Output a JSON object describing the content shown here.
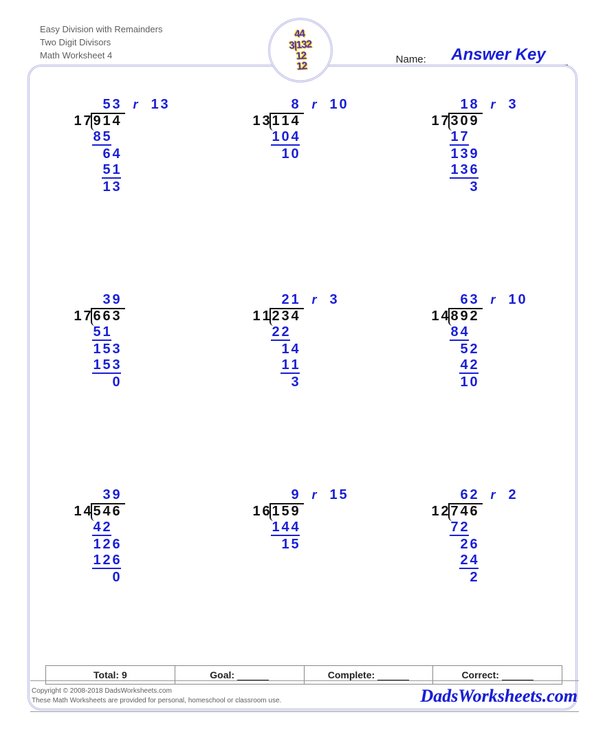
{
  "header": {
    "title_line1": "Easy Division with Remainders",
    "title_line2": "Two Digit Divisors",
    "title_line3": "Math Worksheet 4",
    "name_label": "Name:",
    "name_value": "Answer Key",
    "logo_text": "44\n3|132\n12\n12"
  },
  "problems": [
    {
      "divisor": "17",
      "dividend": "914",
      "quotient": "53",
      "remainder": "13",
      "steps": [
        {
          "val": "85",
          "offset": 0,
          "ul": true
        },
        {
          "val": "64",
          "offset": 1,
          "ul": false
        },
        {
          "val": "51",
          "offset": 1,
          "ul": true
        },
        {
          "val": "13",
          "offset": 1,
          "ul": false
        }
      ]
    },
    {
      "divisor": "13",
      "dividend": "114",
      "quotient": "8",
      "remainder": "10",
      "steps": [
        {
          "val": "104",
          "offset": 0,
          "ul": true
        },
        {
          "val": "10",
          "offset": 1,
          "ul": false
        }
      ]
    },
    {
      "divisor": "17",
      "dividend": "309",
      "quotient": "18",
      "remainder": "3",
      "steps": [
        {
          "val": "17",
          "offset": 0,
          "ul": true
        },
        {
          "val": "139",
          "offset": 0,
          "ul": false
        },
        {
          "val": "136",
          "offset": 0,
          "ul": true
        },
        {
          "val": "3",
          "offset": 2,
          "ul": false
        }
      ]
    },
    {
      "divisor": "17",
      "dividend": "663",
      "quotient": "39",
      "remainder": "",
      "steps": [
        {
          "val": "51",
          "offset": 0,
          "ul": true
        },
        {
          "val": "153",
          "offset": 0,
          "ul": false
        },
        {
          "val": "153",
          "offset": 0,
          "ul": true
        },
        {
          "val": "0",
          "offset": 2,
          "ul": false
        }
      ]
    },
    {
      "divisor": "11",
      "dividend": "234",
      "quotient": "21",
      "remainder": "3",
      "steps": [
        {
          "val": "22",
          "offset": 0,
          "ul": true
        },
        {
          "val": "14",
          "offset": 1,
          "ul": false
        },
        {
          "val": "11",
          "offset": 1,
          "ul": true
        },
        {
          "val": "3",
          "offset": 2,
          "ul": false
        }
      ]
    },
    {
      "divisor": "14",
      "dividend": "892",
      "quotient": "63",
      "remainder": "10",
      "steps": [
        {
          "val": "84",
          "offset": 0,
          "ul": true
        },
        {
          "val": "52",
          "offset": 1,
          "ul": false
        },
        {
          "val": "42",
          "offset": 1,
          "ul": true
        },
        {
          "val": "10",
          "offset": 1,
          "ul": false
        }
      ]
    },
    {
      "divisor": "14",
      "dividend": "546",
      "quotient": "39",
      "remainder": "",
      "steps": [
        {
          "val": "42",
          "offset": 0,
          "ul": true
        },
        {
          "val": "126",
          "offset": 0,
          "ul": false
        },
        {
          "val": "126",
          "offset": 0,
          "ul": true
        },
        {
          "val": "0",
          "offset": 2,
          "ul": false
        }
      ]
    },
    {
      "divisor": "16",
      "dividend": "159",
      "quotient": "9",
      "remainder": "15",
      "steps": [
        {
          "val": "144",
          "offset": 0,
          "ul": true
        },
        {
          "val": "15",
          "offset": 1,
          "ul": false
        }
      ]
    },
    {
      "divisor": "12",
      "dividend": "746",
      "quotient": "62",
      "remainder": "2",
      "steps": [
        {
          "val": "72",
          "offset": 0,
          "ul": true
        },
        {
          "val": "26",
          "offset": 1,
          "ul": false
        },
        {
          "val": "24",
          "offset": 1,
          "ul": true
        },
        {
          "val": "2",
          "offset": 2,
          "ul": false
        }
      ]
    }
  ],
  "footer": {
    "total_label": "Total: 9",
    "goal_label": "Goal:",
    "complete_label": "Complete:",
    "correct_label": "Correct:"
  },
  "copyright": {
    "line1": "Copyright © 2008-2018 DadsWorksheets.com",
    "line2": "These Math Worksheets are provided for personal, homeschool or classroom use.",
    "site": "DadsWorksheets.com"
  }
}
